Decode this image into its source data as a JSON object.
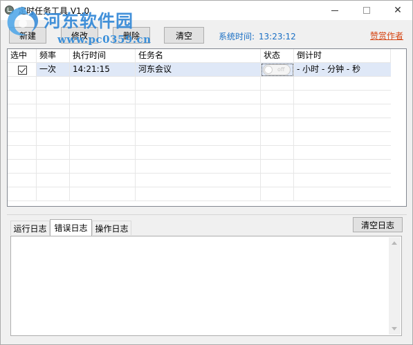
{
  "window": {
    "title": "定时任务工具 V1.0",
    "min_symbol": "—",
    "close_symbol": "✕"
  },
  "watermark": {
    "site_name": "河东软件园",
    "url": "www.pc0359.cn"
  },
  "toolbar": {
    "new_label": "新建",
    "edit_label": "修改",
    "delete_label": "删除",
    "clear_label": "清空",
    "system_time_label": "系统时间:",
    "system_time_value": "13:23:12",
    "donate_label": "赞赏作者"
  },
  "task_table": {
    "columns": [
      "选中",
      "频率",
      "执行时间",
      "任务名",
      "状态",
      "倒计时"
    ],
    "rows": [
      {
        "checked": true,
        "frequency": "一次",
        "exec_time": "14:21:15",
        "task_name": "河东会议",
        "status": "off",
        "countdown": "- 小时  - 分钟  - 秒"
      }
    ]
  },
  "log": {
    "tabs": [
      "运行日志",
      "错误日志",
      "操作日志"
    ],
    "active_tab": "错误日志",
    "clear_label": "清空日志",
    "content": ""
  },
  "colors": {
    "accent_blue": "#1a6fc4",
    "donate_red": "#d64513",
    "selected_row": "#dfe8f7"
  }
}
